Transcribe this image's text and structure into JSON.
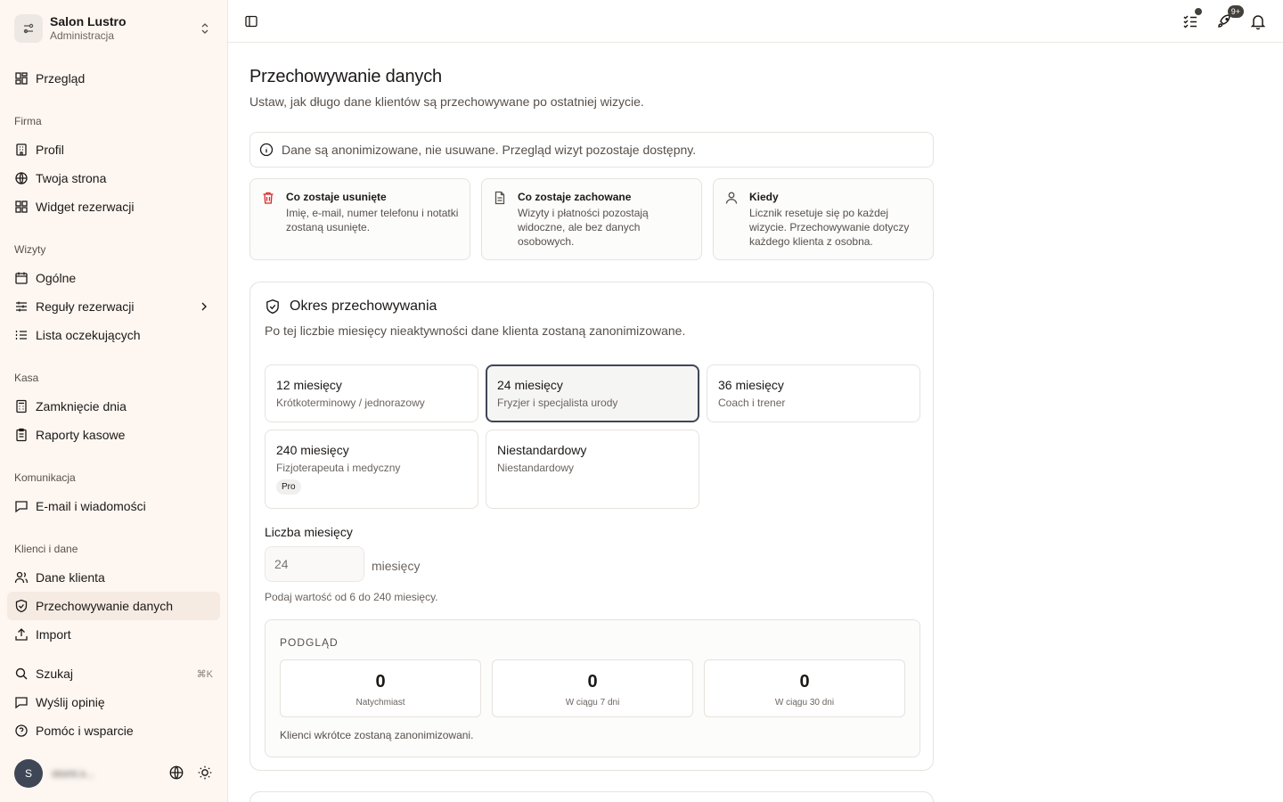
{
  "org": {
    "name": "Salon Lustro",
    "role": "Administracja"
  },
  "nav": {
    "overview": "Przegląd",
    "sections": {
      "firma": "Firma",
      "wizyty": "Wizyty",
      "kasa": "Kasa",
      "komunikacja": "Komunikacja",
      "klienci": "Klienci i dane"
    },
    "profil": "Profil",
    "strona": "Twoja strona",
    "widget": "Widget rezerwacji",
    "ogolne": "Ogólne",
    "reguly": "Reguły rezerwacji",
    "lista": "Lista oczekujących",
    "zamkniecie": "Zamknięcie dnia",
    "raporty": "Raporty kasowe",
    "email": "E-mail i wiadomości",
    "dane": "Dane klienta",
    "przechowywanie": "Przechowywanie danych",
    "import": "Import",
    "szukaj": "Szukaj",
    "szukaj_kbd": "⌘K",
    "opinia": "Wyślij opinię",
    "pomoc": "Pomóc i wsparcie"
  },
  "user": {
    "initial": "S",
    "email": "stomi.s..."
  },
  "topbar": {
    "badge": "9+"
  },
  "page": {
    "title": "Przechowywanie danych",
    "subtitle": "Ustaw, jak długo dane klientów są przechowywane po ostatniej wizycie.",
    "info": "Dane są anonimizowane, nie usuwane. Przegląd wizyt pozostaje dostępny."
  },
  "cards": [
    {
      "title": "Co zostaje usunięte",
      "text": "Imię, e-mail, numer telefonu i notatki zostaną usunięte."
    },
    {
      "title": "Co zostaje zachowane",
      "text": "Wizyty i płatności pozostają widoczne, ale bez danych osobowych."
    },
    {
      "title": "Kiedy",
      "text": "Licznik resetuje się po każdej wizycie. Przechowywanie dotyczy każdego klienta z osobna."
    }
  ],
  "retention": {
    "title": "Okres przechowywania",
    "subtitle": "Po tej liczbie miesięcy nieaktywności dane klienta zostaną zanonimizowane.",
    "options": [
      {
        "title": "12 miesięcy",
        "desc": "Krótkoterminowy / jednorazowy"
      },
      {
        "title": "24 miesięcy",
        "desc": "Fryzjer i specjalista urody"
      },
      {
        "title": "36 miesięcy",
        "desc": "Coach i trener"
      },
      {
        "title": "240 miesięcy",
        "desc": "Fizjoterapeuta i medyczny",
        "badge": "Pro"
      },
      {
        "title": "Niestandardowy",
        "desc": "Niestandardowy"
      }
    ],
    "selected_index": 1,
    "field_label": "Liczba miesięcy",
    "field_placeholder": "24",
    "unit": "miesięcy",
    "hint": "Podaj wartość od 6 do 240 miesięcy."
  },
  "preview": {
    "label": "PODGLĄD",
    "stats": [
      {
        "value": "0",
        "label": "Natychmiast"
      },
      {
        "value": "0",
        "label": "W ciągu 7 dni"
      },
      {
        "value": "0",
        "label": "W ciągu 30 dni"
      }
    ],
    "note": "Klienci wkrótce zostaną zanonimizowani."
  }
}
